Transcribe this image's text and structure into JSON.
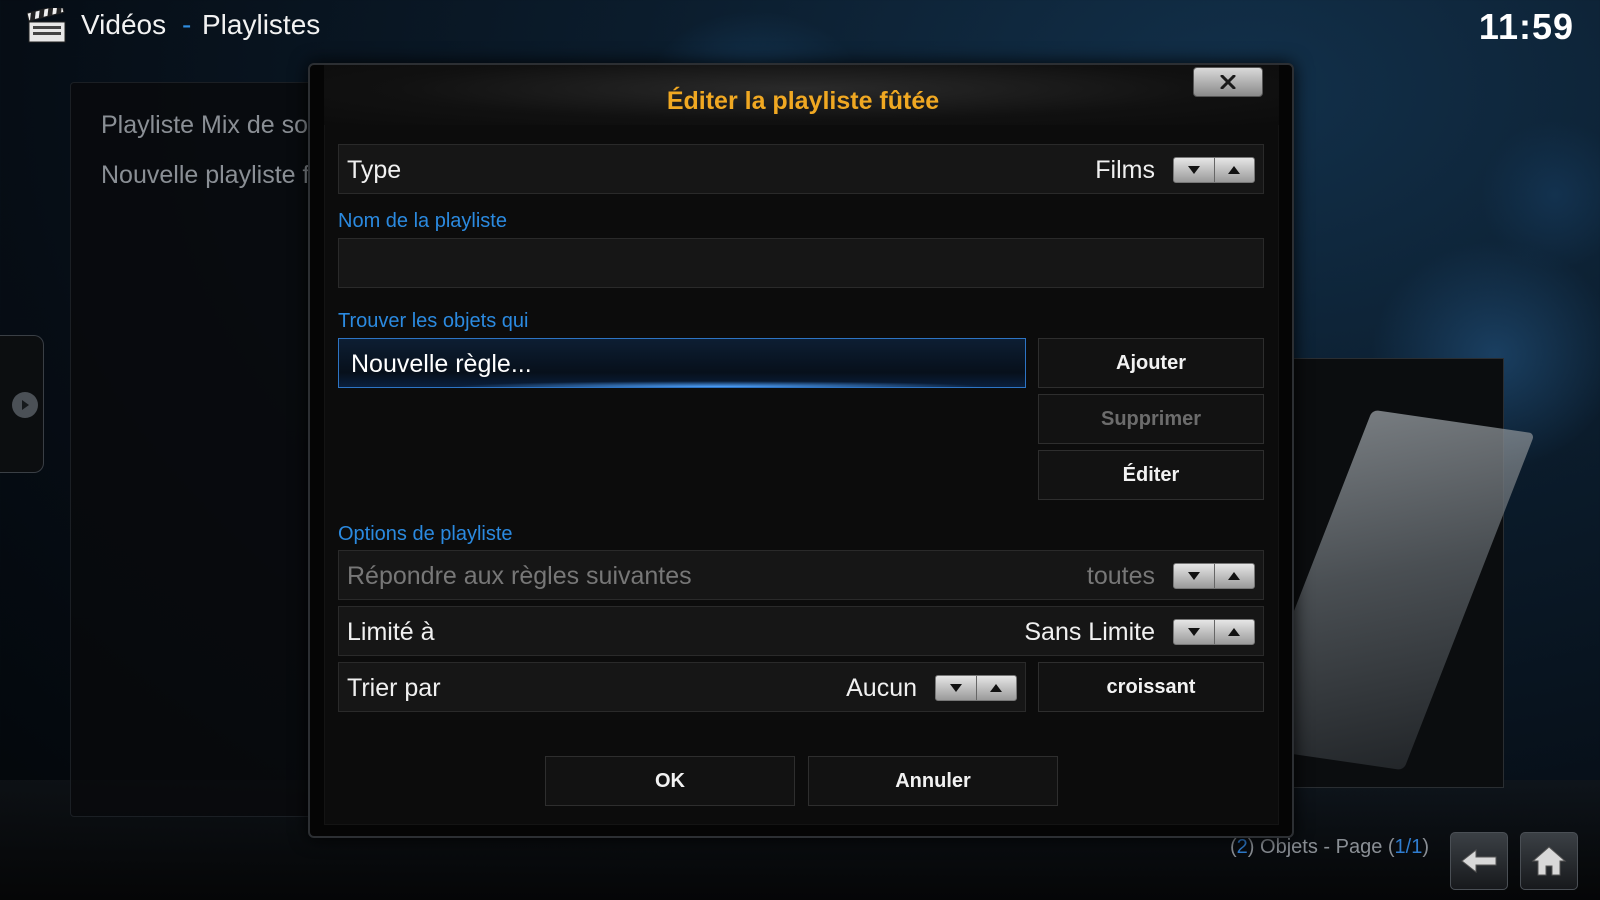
{
  "header": {
    "title": "Vidéos",
    "separator": "-",
    "subtitle": "Playlistes",
    "clock": "11:59"
  },
  "sidebar": {
    "items": [
      {
        "label": "Playliste Mix de so"
      },
      {
        "label": "Nouvelle playliste f"
      }
    ]
  },
  "status": {
    "count_open": "(",
    "count": "2",
    "count_close": ")",
    "objects_label": " Objets - Page ",
    "page_open": "(",
    "page": "1/1",
    "page_close": ")"
  },
  "dialog": {
    "title": "Éditer la playliste fûtée",
    "type": {
      "label": "Type",
      "value": "Films"
    },
    "name_section": "Nom de la playliste",
    "name_value": "",
    "rules_section": "Trouver les objets qui",
    "rules": [
      {
        "label": "Nouvelle règle..."
      }
    ],
    "buttons": {
      "add": "Ajouter",
      "remove": "Supprimer",
      "edit": "Éditer",
      "sort_direction": "croissant",
      "ok": "OK",
      "cancel": "Annuler"
    },
    "options_section": "Options de playliste",
    "match": {
      "label": "Répondre aux règles suivantes",
      "value": "toutes"
    },
    "limit": {
      "label": "Limité à",
      "value": "Sans Limite"
    },
    "sort": {
      "label": "Trier par",
      "value": "Aucun"
    }
  },
  "colors": {
    "accent": "#2b8ae0",
    "title": "#f0a822",
    "focus_border": "#2d74c4"
  }
}
